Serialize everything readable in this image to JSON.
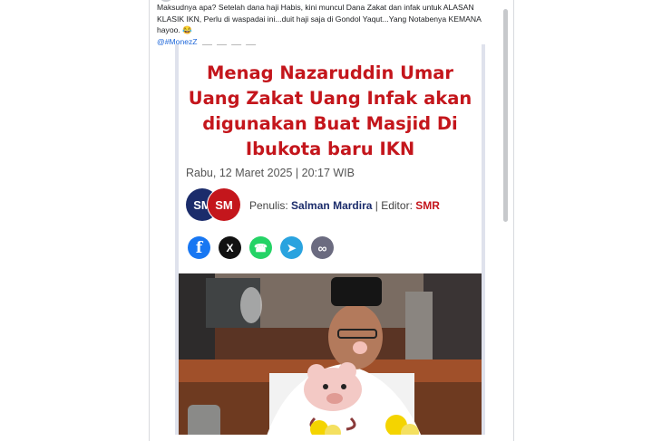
{
  "post": {
    "text": "Maksudnya apa? Setelah dana haji Habis, kini muncul Dana Zakat dan infak untuk ALASAN KLASIK IKN, Perlu di waspadai ini...duit haji saja di Gondol Yaqut...Yang Notabenya KEMANA hayoo. 😂",
    "mention": "@#MonezZ"
  },
  "article": {
    "headline": "Menag Nazaruddin Umar Uang Zakat Uang Infak akan digunakan Buat Masjid Di Ibukota baru IKN",
    "date": "Rabu, 12 Maret 2025 | 20:17 WIB",
    "logo_left": "SM",
    "logo_right": "SM",
    "author_prefix": "Penulis:",
    "author_name": "Salman Mardira",
    "editor_prefix": "| Editor:",
    "editor_name": "SMR"
  },
  "share": {
    "facebook": "f",
    "x": "X",
    "whatsapp": "☎",
    "telegram": "➤",
    "link": "∞"
  },
  "colors": {
    "headline": "#c4161c",
    "brand_navy": "#1b2c6b",
    "facebook": "#1877f2",
    "x": "#111111",
    "whatsapp": "#25d366",
    "telegram": "#2aa3df",
    "link": "#6b6b80"
  }
}
